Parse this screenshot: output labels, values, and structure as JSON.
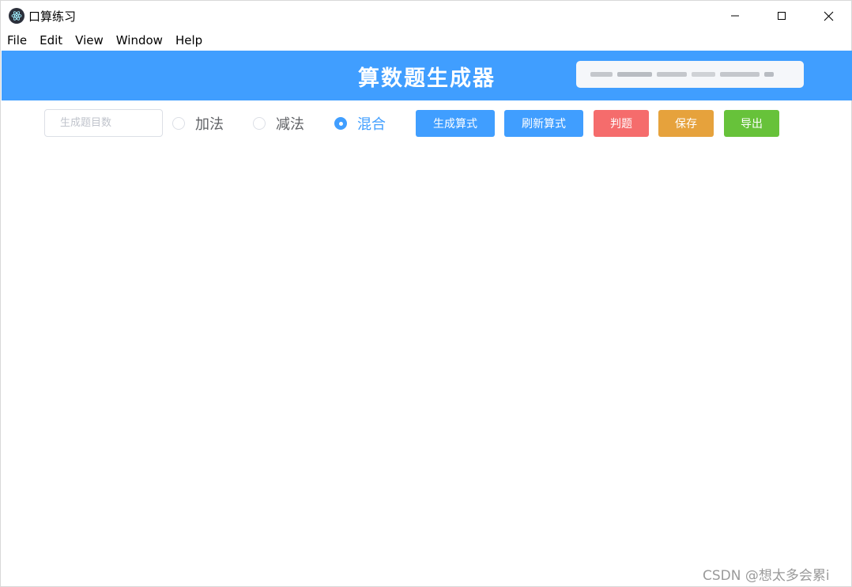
{
  "window": {
    "title": "口算练习",
    "icon": "electron-icon",
    "controls": {
      "minimize": "minimize-icon",
      "maximize": "maximize-icon",
      "close": "close-icon"
    }
  },
  "menubar": {
    "items": [
      {
        "label": "File"
      },
      {
        "label": "Edit"
      },
      {
        "label": "View"
      },
      {
        "label": "Window"
      },
      {
        "label": "Help"
      }
    ]
  },
  "header": {
    "title": "算数题生成器",
    "background": "#409eff"
  },
  "toolbar": {
    "count_input": {
      "placeholder": "生成题目数",
      "value": ""
    },
    "radios": [
      {
        "label": "加法",
        "checked": false
      },
      {
        "label": "减法",
        "checked": false
      },
      {
        "label": "混合",
        "checked": true
      }
    ],
    "buttons": [
      {
        "label": "生成算式",
        "color": "#409eff"
      },
      {
        "label": "刷新算式",
        "color": "#409eff"
      },
      {
        "label": "判题",
        "color": "#f56c6c"
      },
      {
        "label": "保存",
        "color": "#e6a23c"
      },
      {
        "label": "导出",
        "color": "#67c23a"
      }
    ]
  },
  "watermark": "CSDN @想太多会累i"
}
